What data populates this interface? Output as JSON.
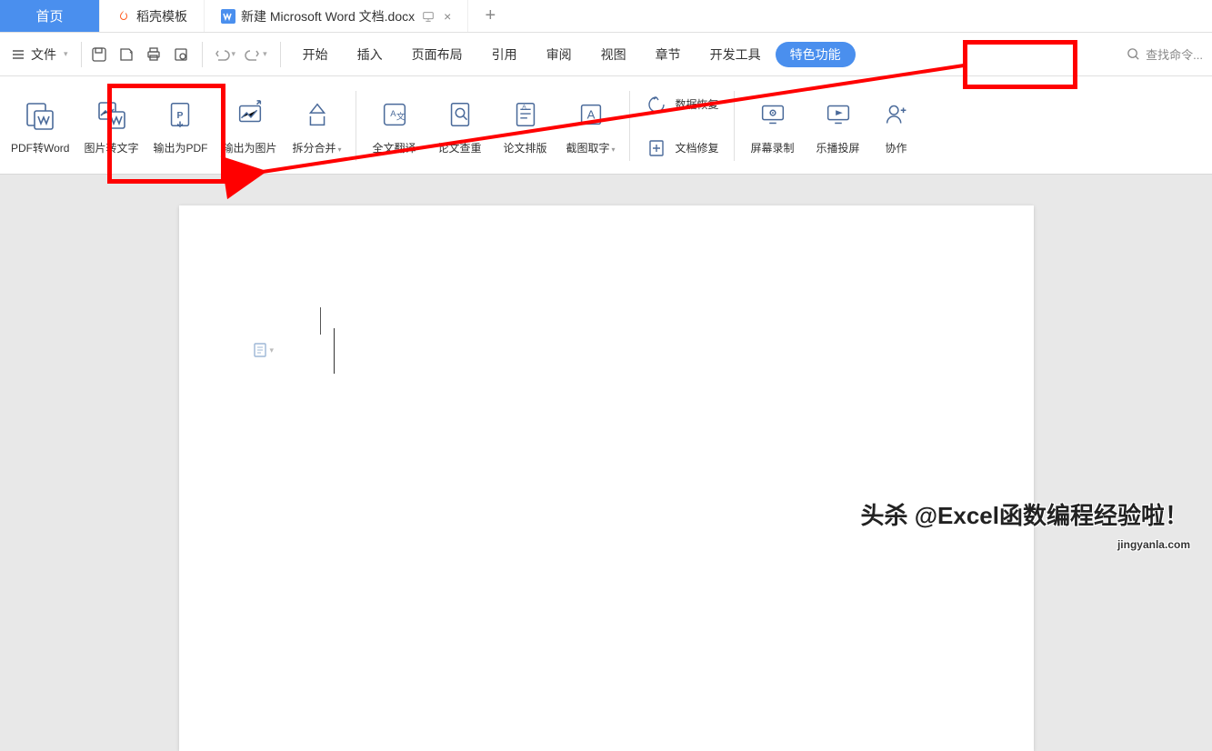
{
  "tabs": {
    "home": "首页",
    "template": "稻壳模板",
    "doc": "新建 Microsoft Word 文档.docx",
    "close": "×",
    "add": "+"
  },
  "menu": {
    "file": "文件",
    "items": [
      "开始",
      "插入",
      "页面布局",
      "引用",
      "审阅",
      "视图",
      "章节",
      "开发工具"
    ],
    "special": "特色功能",
    "search_placeholder": "查找命令..."
  },
  "ribbon": {
    "pdf2word": "PDF转Word",
    "ocr": "图片转文字",
    "out_pdf": "输出为PDF",
    "out_img": "输出为图片",
    "split": "拆分合并",
    "translate": "全文翻译",
    "dup": "论文查重",
    "typeset": "论文排版",
    "capture": "截图取字",
    "data_recover": "数据恢复",
    "doc_repair": "文档修复",
    "screen_rec": "屏幕录制",
    "cast": "乐播投屏",
    "collab": "协作"
  },
  "watermark": {
    "main": "头杀 @Excel函数编程经验啦！",
    "sub": "jingyanla.com"
  },
  "colors": {
    "accent": "#4a8fee",
    "annot": "#f00"
  }
}
